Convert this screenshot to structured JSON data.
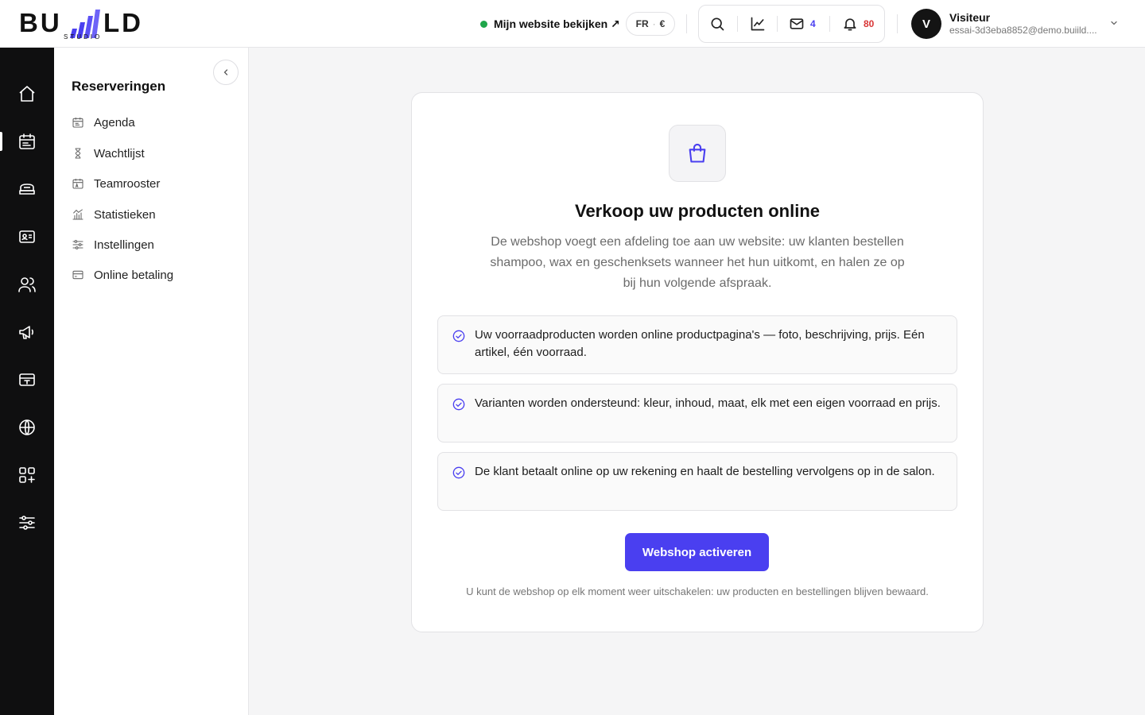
{
  "brand": {
    "name_part1": "BU",
    "name_part2": "LD",
    "sub": "STUDIO",
    "accent": "#4a3ff0"
  },
  "header": {
    "view_site_label": "Mijn website bekijken ↗",
    "lang": "FR",
    "currency": "€",
    "mail_count": "4",
    "notif_count": "80",
    "icons": [
      "search-icon",
      "chart-line-icon",
      "mail-icon",
      "bell-icon"
    ],
    "user": {
      "initial": "V",
      "name": "Visiteur",
      "email": "essai-3d3eba8852@demo.buiild...."
    }
  },
  "rail": {
    "items": [
      "home-icon",
      "calendar-icon",
      "services-icon",
      "id-card-icon",
      "users-icon",
      "megaphone-icon",
      "register-icon",
      "globe-icon",
      "apps-add-icon",
      "settings-sliders-icon"
    ],
    "active_index": 1
  },
  "sidebar": {
    "title": "Reserveringen",
    "items": [
      {
        "label": "Agenda",
        "icon": "calendar-icon"
      },
      {
        "label": "Wachtlijst",
        "icon": "hourglass-icon"
      },
      {
        "label": "Teamrooster",
        "icon": "calendar-team-icon"
      },
      {
        "label": "Statistieken",
        "icon": "stats-icon"
      },
      {
        "label": "Instellingen",
        "icon": "sliders-icon"
      },
      {
        "label": "Online betaling",
        "icon": "credit-card-icon"
      }
    ]
  },
  "main": {
    "title": "Verkoop uw producten online",
    "description": "De webshop voegt een afdeling toe aan uw website: uw klanten bestellen shampoo, wax en geschenksets wanneer het hun uitkomt, en halen ze op bij hun volgende afspraak.",
    "features": [
      "Uw voorraadproducten worden online productpagina's — foto, beschrijving, prijs. Eén artikel, één voorraad.",
      "Varianten worden ondersteund: kleur, inhoud, maat, elk met een eigen voorraad en prijs.",
      "De klant betaalt online op uw rekening en haalt de bestelling vervolgens op in de salon."
    ],
    "cta_label": "Webshop activeren",
    "note": "U kunt de webshop op elk moment weer uitschakelen: uw producten en bestellingen blijven bewaard."
  }
}
